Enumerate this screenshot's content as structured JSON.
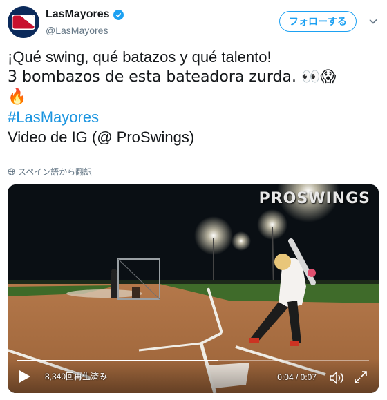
{
  "account": {
    "name": "LasMayores",
    "handle": "@LasMayores",
    "follow_label": "フォローする"
  },
  "tweet": {
    "line1": "¡Qué swing, qué batazos y qué talento!",
    "line2": "3 bombazos de esta bateadora zurda. 👀😱",
    "line3": "🔥",
    "hashtag": "#LasMayores",
    "line5": "Video de IG (@ ProSwings)",
    "translate_label": "スペイン語から翻訳"
  },
  "video": {
    "watermark": "PROSWINGS",
    "views": "8,340回再生済み",
    "time": "0:04 / 0:07",
    "progress": 0.57
  },
  "colors": {
    "accent": "#1da1f2",
    "hashtag": "#1b95e0",
    "secondary_text": "#657786"
  },
  "icons": [
    "mlb-logo-icon",
    "verified-icon",
    "chevron-down-icon",
    "globe-icon",
    "play-icon",
    "volume-icon",
    "fullscreen-icon"
  ]
}
